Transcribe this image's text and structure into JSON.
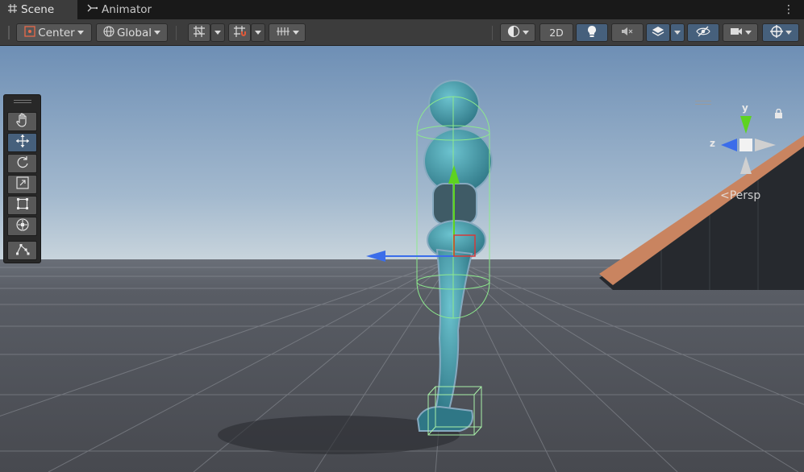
{
  "tabs": [
    {
      "label": "Scene",
      "icon": "grid-icon",
      "active": true
    },
    {
      "label": "Animator",
      "icon": "animator-icon",
      "active": false
    }
  ],
  "toolbar": {
    "pivot_label": "Center",
    "space_label": "Global",
    "mode_2d_label": "2D"
  },
  "gizmo": {
    "y_label": "y",
    "z_label": "z",
    "projection_label": "Persp"
  },
  "tools": [
    "hand-tool",
    "move-tool",
    "rotate-tool",
    "scale-tool",
    "rect-tool",
    "transform-tool",
    "custom-tool"
  ],
  "colors": {
    "accent_blue": "#46607c",
    "axis_x": "#d53a3a",
    "axis_y": "#5ed321",
    "axis_z": "#3b6dea",
    "character": "#3a8d9e",
    "collider": "#8dea8d",
    "ramp": "#c98460"
  }
}
